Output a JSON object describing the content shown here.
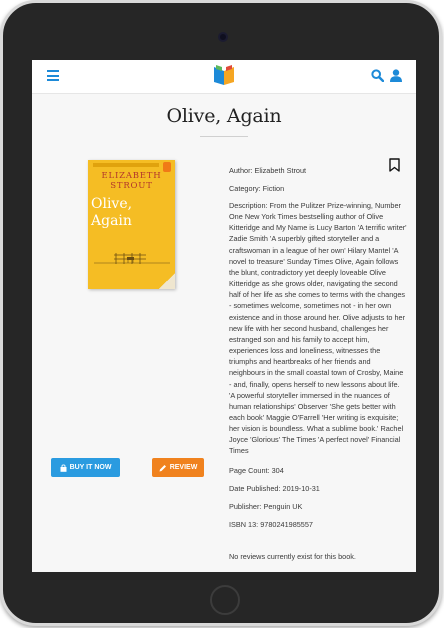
{
  "navbar": {
    "menu_icon": "hamburger-menu-icon",
    "logo_icon": "open-book-logo-icon",
    "search_icon": "search-icon",
    "user_icon": "user-icon",
    "accent_color": "#1d8ad8"
  },
  "book": {
    "title": "Olive, Again",
    "cover": {
      "author_line1": "ELIZABETH",
      "author_line2": "STROUT",
      "title_line1": "Olive,",
      "title_line2": "Again",
      "background_color": "#f5bd24"
    },
    "author": "Author: Elizabeth Strout",
    "category": "Category: Fiction",
    "description": "Description: From the Pulitzer Prize-winning, Number One New York Times bestselling author of Olive Kitteridge and My Name is Lucy Barton 'A terrific writer' Zadie Smith 'A superbly gifted storyteller and a craftswoman in a league of her own' Hilary Mantel 'A novel to treasure' Sunday Times Olive, Again follows the blunt, contradictory yet deeply loveable Olive Kitteridge as she grows older, navigating the second half of her life as she comes to terms with the changes - sometimes welcome, sometimes not - in her own existence and in those around her. Olive adjusts to her new life with her second husband, challenges her estranged son and his family to accept him, experiences loss and loneliness, witnesses the triumphs and heartbreaks of her friends and neighbours in the small coastal town of Crosby, Maine - and, finally, opens herself to new lessons about life. 'A powerful storyteller immersed in the nuances of human relationships' Observer 'She gets better with each book' Maggie O'Farrell 'Her writing is exquisite; her vision is boundless. What a sublime book.' Rachel Joyce 'Glorious' The Times 'A perfect novel' Financial Times",
    "page_count": "Page Count: 304",
    "date_published": "Date Published: 2019-10-31",
    "publisher": "Publisher: Penguin UK",
    "isbn": "ISBN 13: 9780241985557",
    "bookmark_icon": "bookmark-icon"
  },
  "actions": {
    "buy_label": "BUY IT NOW",
    "buy_icon": "shopping-bag-icon",
    "buy_color": "#2a9be0",
    "review_label": "REVIEW",
    "review_icon": "pencil-icon",
    "review_color": "#f0821e"
  },
  "reviews": {
    "empty_message": "No reviews currently exist for this book."
  }
}
